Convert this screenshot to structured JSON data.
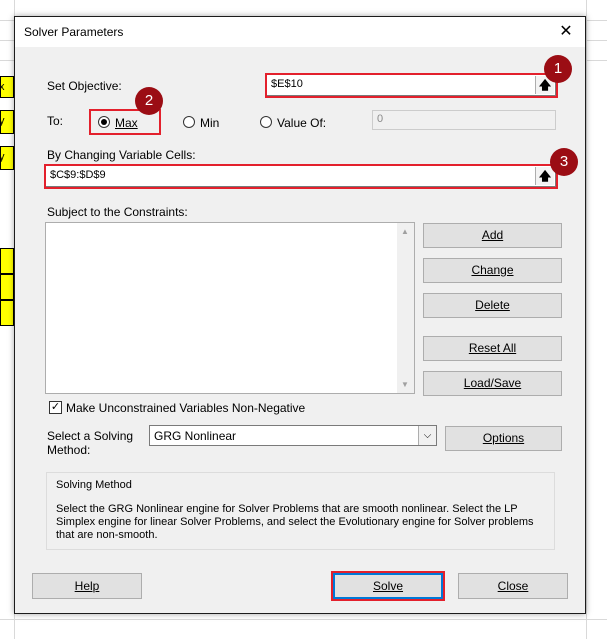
{
  "dialog": {
    "title": "Solver Parameters",
    "close_symbol": "✕"
  },
  "objective": {
    "label": "Set Objective:",
    "value": "$E$10",
    "ref_symbol": "🡅"
  },
  "to": {
    "label": "To:",
    "max_label": "Max",
    "min_label": "Min",
    "value_of_label": "Value Of:",
    "value_of_value": "0",
    "selected": "Max"
  },
  "changing": {
    "label": "By Changing Variable Cells:",
    "value": "$C$9:$D$9",
    "ref_symbol": "🡅"
  },
  "constraints": {
    "label": "Subject to the Constraints:",
    "items": []
  },
  "buttons": {
    "add": "Add",
    "change": "Change",
    "delete": "Delete",
    "reset_all": "Reset All",
    "load_save": "Load/Save",
    "options": "Options",
    "help": "Help",
    "solve": "Solve",
    "close": "Close"
  },
  "nonneg": {
    "label": "Make Unconstrained Variables Non-Negative",
    "checked": true
  },
  "method": {
    "label_line1": "Select a Solving",
    "label_line2": "Method:",
    "selected": "GRG Nonlinear"
  },
  "solving_method": {
    "title": "Solving Method",
    "description": "Select the GRG Nonlinear engine for Solver Problems that are smooth nonlinear. Select the LP Simplex engine for linear Solver Problems, and select the Evolutionary engine for Solver problems that are non-smooth."
  },
  "badges": [
    "1",
    "2",
    "3"
  ],
  "sheet_fragments": [
    "x +",
    "y <",
    "y <"
  ],
  "colors": {
    "highlight": "#e3202c",
    "badge": "#9b0d14",
    "cell_yellow": "#ffff00",
    "primary_border": "#0078d7"
  }
}
